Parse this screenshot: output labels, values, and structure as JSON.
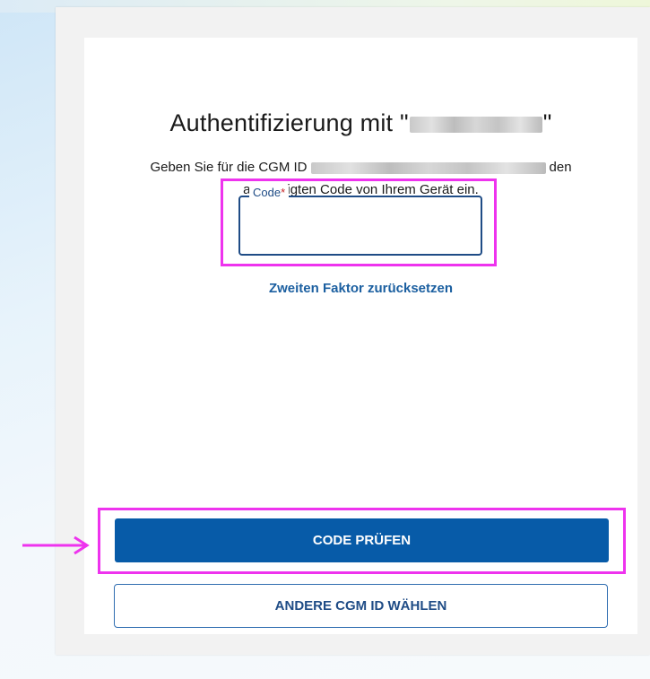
{
  "title": {
    "prefix": "Authentifizierung mit \"",
    "suffix": "\""
  },
  "subtitle": {
    "before": "Geben Sie für die CGM ID",
    "after": "den",
    "line2": "angezeigten Code von Ihrem Gerät ein."
  },
  "code_field": {
    "label": "Code",
    "required_mark": "*",
    "value": ""
  },
  "reset_link": "Zweiten Faktor zurücksetzen",
  "buttons": {
    "primary": "CODE PRÜFEN",
    "secondary": "ANDERE CGM ID WÄHLEN"
  },
  "colors": {
    "primary": "#075ba8",
    "link": "#1b5fa0",
    "field_border": "#1f4c86",
    "highlight": "#ee33ee",
    "required": "#c62828"
  },
  "annotations": {
    "arrow_icon": "arrow-right-icon"
  }
}
